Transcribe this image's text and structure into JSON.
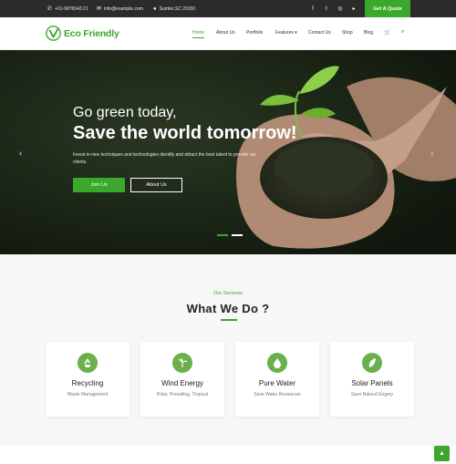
{
  "topbar": {
    "phone": "+01-9876543 21",
    "email": "info@example.com",
    "address": "Sumter,SC 29150",
    "social_icons": [
      "facebook-icon",
      "twitter-icon",
      "instagram-icon",
      "youtube-icon"
    ],
    "quote_label": "Get A Quote"
  },
  "header": {
    "logo_text": "Eco Friendly",
    "nav": [
      "Home",
      "About Us",
      "Portfolio",
      "Features",
      "Contact Us",
      "Shop",
      "Blog"
    ],
    "active_nav": "Home",
    "features_chevron": "▾",
    "cart_icon": "cart-icon",
    "search_icon": "search-icon"
  },
  "hero": {
    "subtitle": "Go green today,",
    "title": "Save the world tomorrow!",
    "text": "Invest in new techniques and technologies identify and attract the best talent to provide our clients.",
    "join_label": "Join Us",
    "about_label": "About Us",
    "slides": 2,
    "active_slide": 1
  },
  "services": {
    "kicker": "Our Services",
    "title": "What We Do ?",
    "items": [
      {
        "title": "Recycling",
        "subtitle": "Waste Management",
        "icon": "recycle-icon"
      },
      {
        "title": "Wind Energy",
        "subtitle": "Polar, Prevailing, Tropical",
        "icon": "wind-turbine-icon"
      },
      {
        "title": "Pure Water",
        "subtitle": "Save Water Resources",
        "icon": "water-drop-icon"
      },
      {
        "title": "Solar Panels",
        "subtitle": "Save Natural Engery",
        "icon": "solar-leaf-icon"
      }
    ]
  },
  "colors": {
    "brand_green": "#3aa82a",
    "topbar": "#2b2b2b",
    "icon_circle": "#6ab04c"
  }
}
